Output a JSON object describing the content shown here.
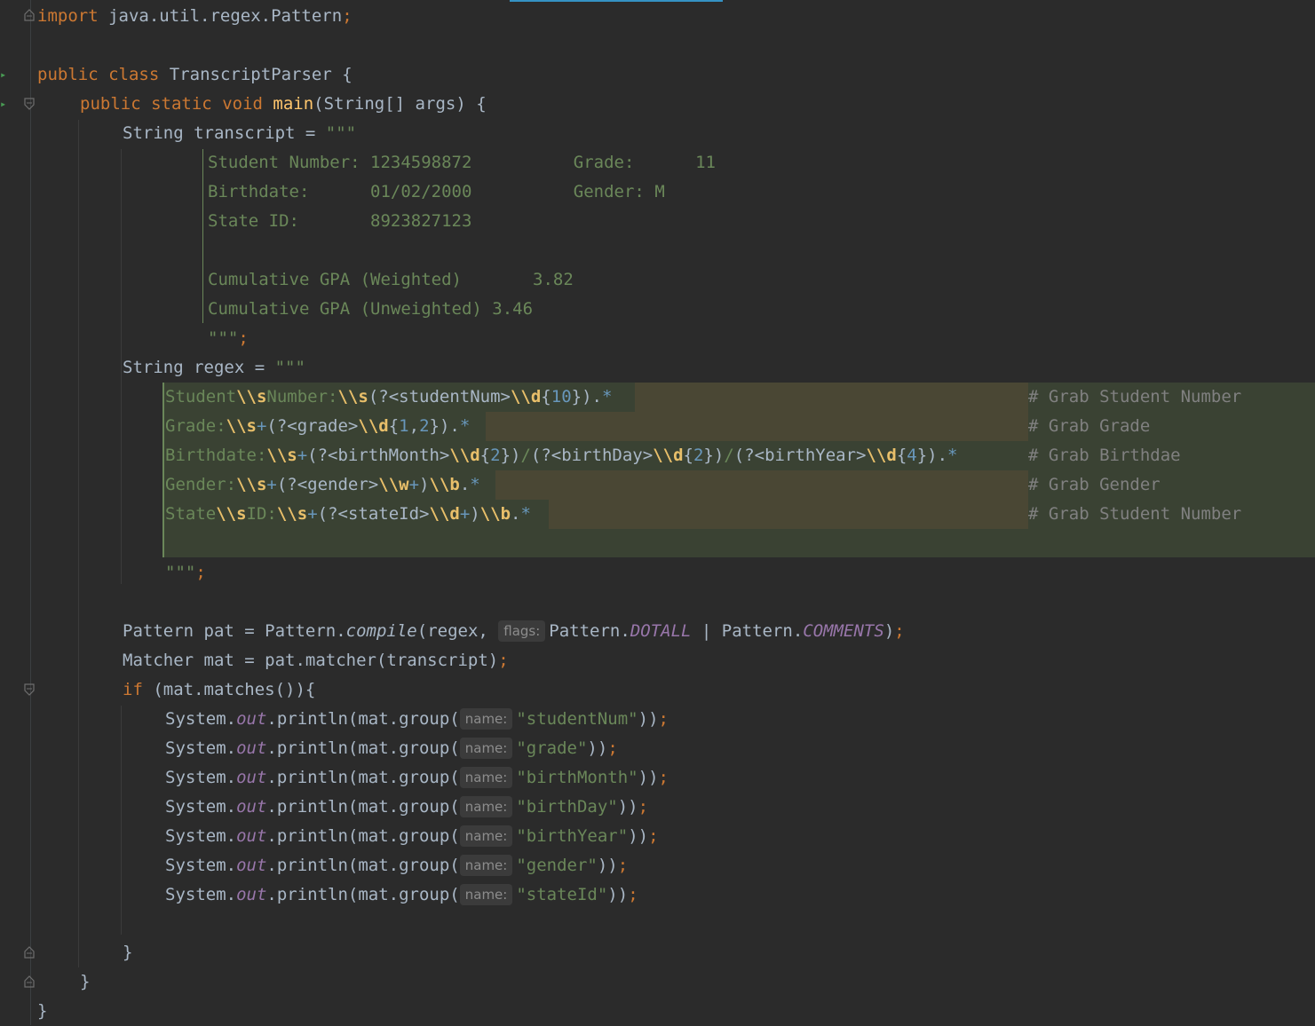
{
  "editor": {
    "import_kw": "import",
    "import_path": "java.util.regex.Pattern",
    "class_decl": {
      "kw1": "public",
      "kw2": "class",
      "name": "TranscriptParser",
      "brace": "{"
    },
    "main_decl": {
      "kw1": "public",
      "kw2": "static",
      "kw3": "void",
      "name": "main",
      "params": "(String[] args) {"
    },
    "transcript_decl": "String transcript = ",
    "text_block_open": "\"\"\"",
    "transcript_lines": [
      "Student Number: 1234598872          Grade:      11",
      "Birthdate:      01/02/2000          Gender: M",
      "State ID:       8923827123",
      "",
      "Cumulative GPA (Weighted)       3.82",
      "Cumulative GPA (Unweighted) 3.46"
    ],
    "text_block_close": "\"\"\"",
    "regex_decl": "String regex = ",
    "regex_comments": [
      "# Grab Student Number",
      "# Grab Grade",
      "# Grab Birthdae",
      "# Grab Gender",
      "# Grab Student Number"
    ],
    "pattern_line": {
      "decl": "Pattern pat = Pattern.",
      "method": "compile",
      "arg1": "(regex, ",
      "hint": "flags:",
      "cls1": "Pattern.",
      "f1": "DOTALL",
      "sep": " | ",
      "cls2": "Pattern.",
      "f2": "COMMENTS",
      "end": ")"
    },
    "matcher_line": "Matcher mat = pat.matcher(transcript)",
    "if_line": {
      "kw": "if",
      "rest": " (mat.matches()){"
    },
    "println_hint": "name:",
    "println_groups": [
      "\"studentNum\"",
      "\"grade\"",
      "\"birthMonth\"",
      "\"birthDay\"",
      "\"birthYear\"",
      "\"gender\"",
      "\"stateId\""
    ],
    "println_prefix": "System.",
    "println_out": "out",
    "println_call": ".println(mat.group(",
    "println_end": "))",
    "semicolon": ";",
    "close_brace": "}"
  }
}
